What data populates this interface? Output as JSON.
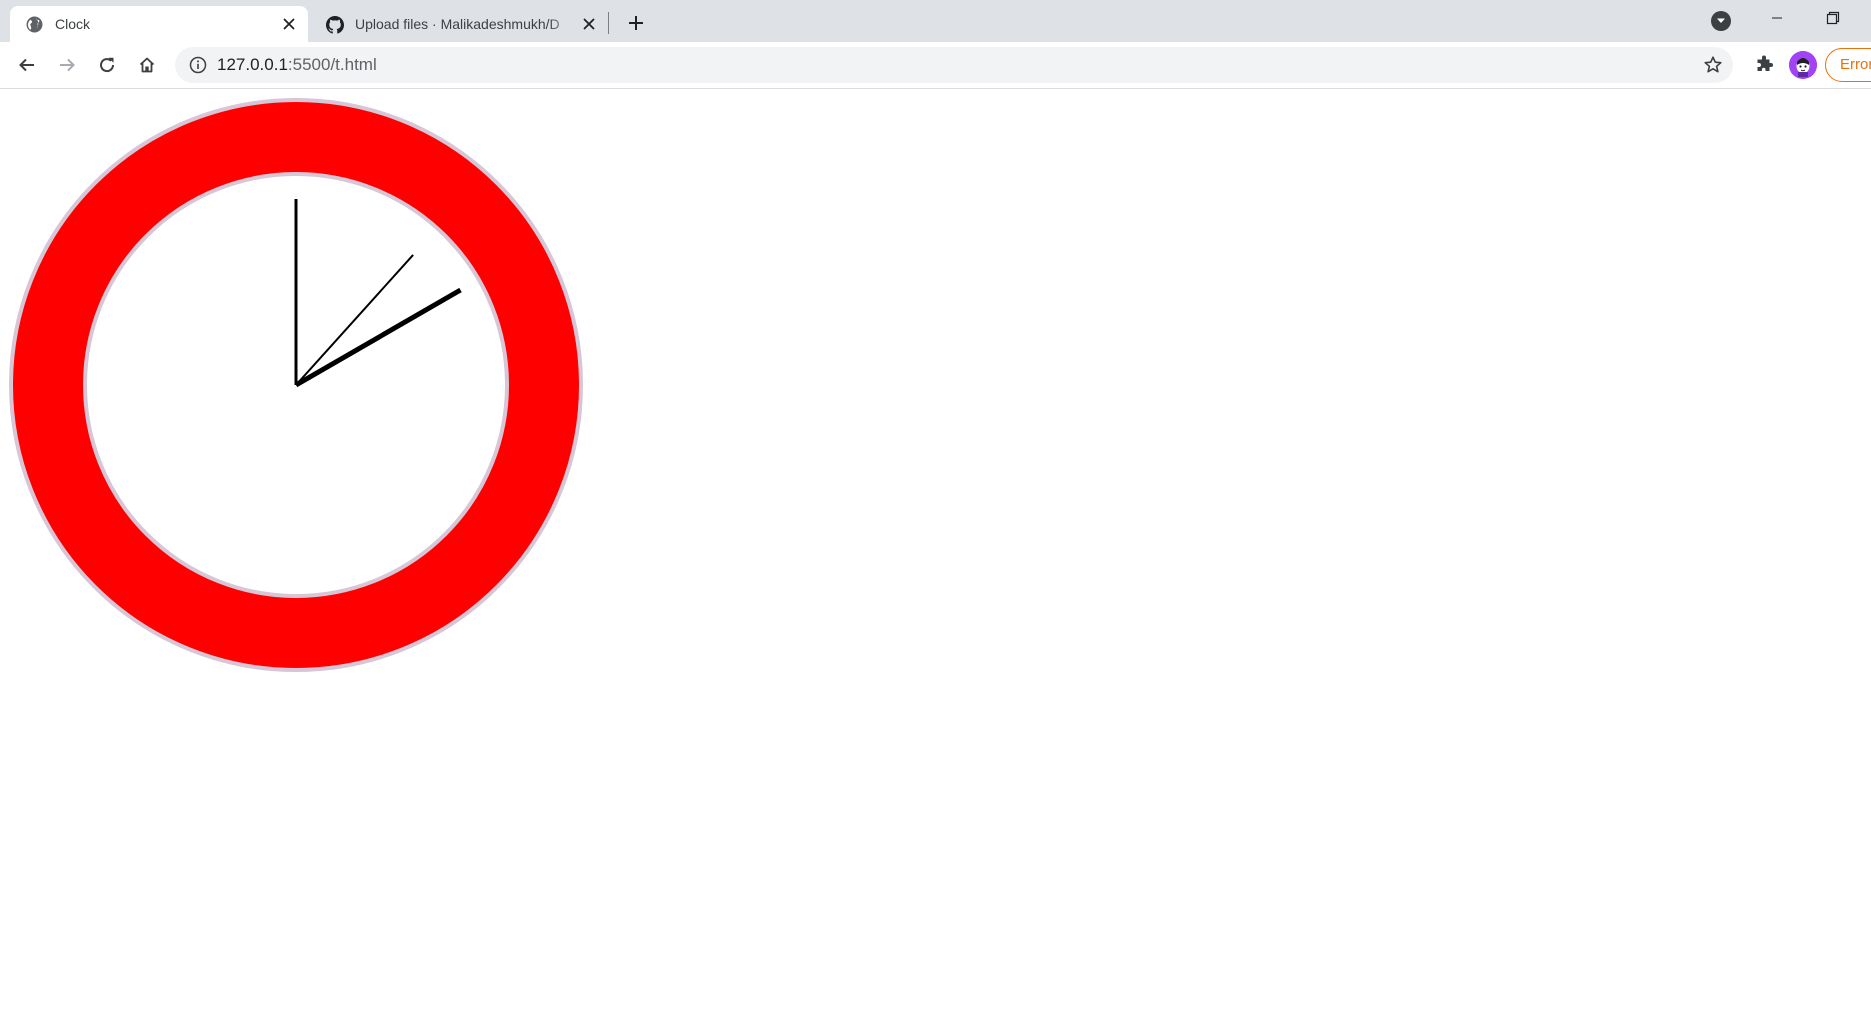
{
  "tabs": [
    {
      "title": "Clock",
      "active": true,
      "favicon": "globe-icon"
    },
    {
      "title": "Upload files · Malikadeshmukh/D",
      "active": false,
      "favicon": "github-icon"
    }
  ],
  "toolbar": {
    "url_host": "127.0.0.1",
    "url_path": ":5500/t.html",
    "error_label": "Error"
  },
  "clock": {
    "ring_color": "#ff0000",
    "ring_border_color": "#d6c6d6",
    "face_color": "#ffffff",
    "hand_color": "#000000",
    "time": {
      "hour": 2,
      "minute": 0,
      "second": 7
    }
  },
  "colors": {
    "tabstrip_bg": "#dee1e6",
    "omnibox_bg": "#f1f3f4",
    "avatar_bg": "#a142f4",
    "error_accent": "#e8710a"
  }
}
